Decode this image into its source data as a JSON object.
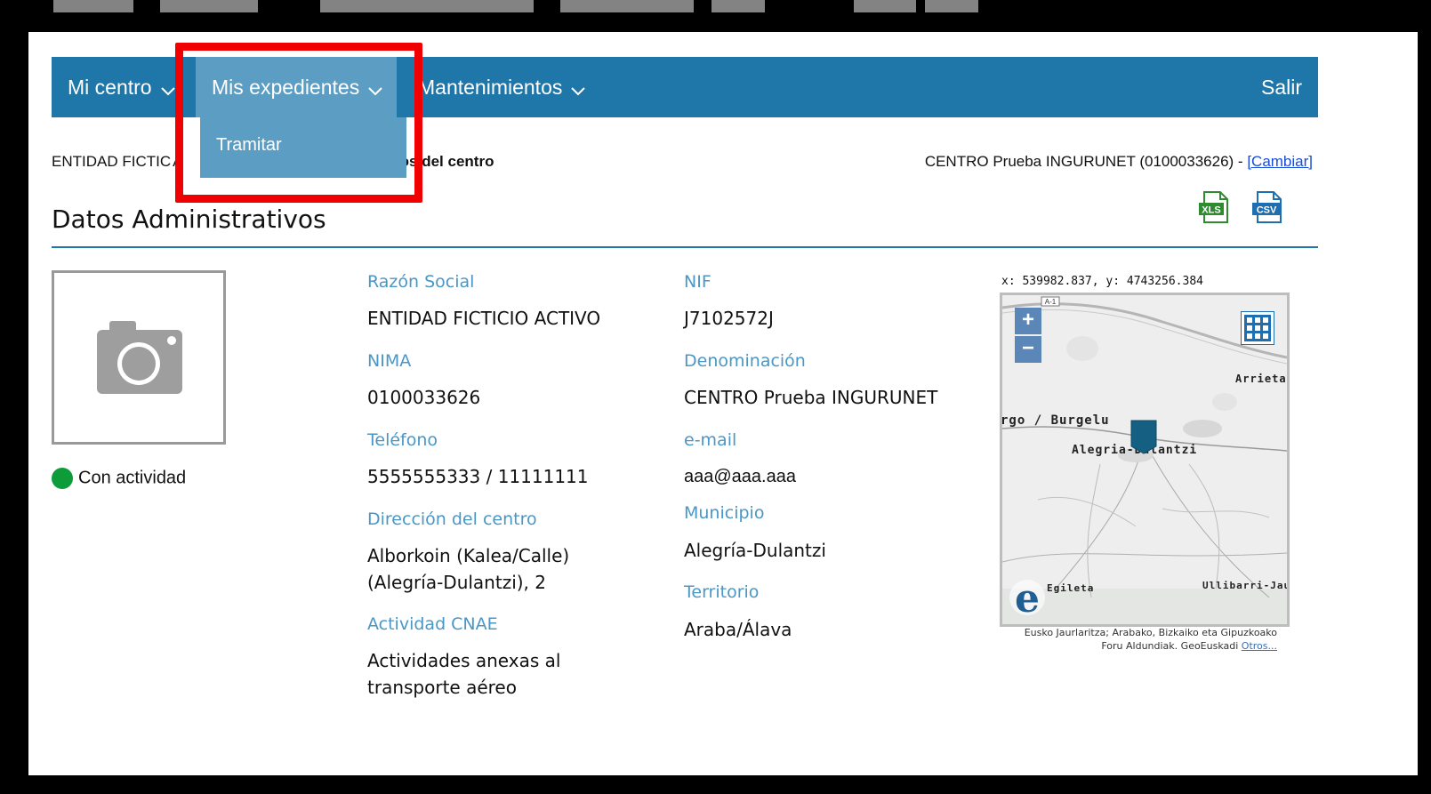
{
  "nav": {
    "items": [
      {
        "label": "Mi centro"
      },
      {
        "label": "Mis expedientes"
      },
      {
        "label": "Mantenimientos"
      }
    ],
    "logout": "Salir",
    "dropdown_item": "Tramitar"
  },
  "breadcrumb": {
    "entity": "ENTIDAD FICTIC",
    "entity_tail": "A",
    "current": "tos del centro"
  },
  "centre_info": {
    "text": "CENTRO Prueba INGURUNET (0100033626) -",
    "change_link": "[Cambiar]"
  },
  "exports": {
    "xls": "XLS",
    "csv": "CSV"
  },
  "page_title": "Datos Administrativos",
  "status_label": "Con actividad",
  "fields": {
    "razon_social": {
      "label": "Razón Social",
      "value": "ENTIDAD FICTICIO ACTIVO"
    },
    "nima": {
      "label": "NIMA",
      "value": "0100033626"
    },
    "telefono": {
      "label": "Teléfono",
      "value": "5555555333 / 11111111"
    },
    "direccion": {
      "label": "Dirección del centro",
      "value_line1": "Alborkoin (Kalea/Calle)",
      "value_line2": "(Alegría-Dulantzi), 2"
    },
    "actividad": {
      "label": "Actividad CNAE",
      "value_line1": "Actividades anexas al",
      "value_line2": "transporte aéreo"
    },
    "nif": {
      "label": "NIF",
      "value": "J7102572J"
    },
    "denominacion": {
      "label": "Denominación",
      "value": "CENTRO Prueba INGURUNET"
    },
    "email": {
      "label": "e-mail",
      "value": "aaa@aaa.aaa"
    },
    "municipio": {
      "label": "Municipio",
      "value": "Alegría-Dulantzi"
    },
    "territorio": {
      "label": "Territorio",
      "value": "Araba/Álava"
    }
  },
  "map": {
    "coords": "x: 539982.837, y: 4743256.384",
    "road_label": "A-1",
    "towns": {
      "arrieta": "Arrieta",
      "burgelu": "rgo / Burgelu",
      "alegria": "Alegria-Dulantzi",
      "egileta": "Egileta",
      "ullibarri": "Ullibarri-Jaur"
    },
    "zoom_in": "+",
    "zoom_out": "−",
    "attribution_line1": "Eusko Jaurlaritza; Arabako, Bizkaiko eta Gipuzkoako",
    "attribution_line2": "Foru Aldundiak. GeoEuskadi",
    "attribution_link": "Otros..."
  },
  "colors": {
    "nav_bg": "#1f76a9",
    "nav_open": "#5b9dc3",
    "label": "#4a97c6",
    "status_green": "#0e9b3a",
    "highlight": "#f00000"
  }
}
